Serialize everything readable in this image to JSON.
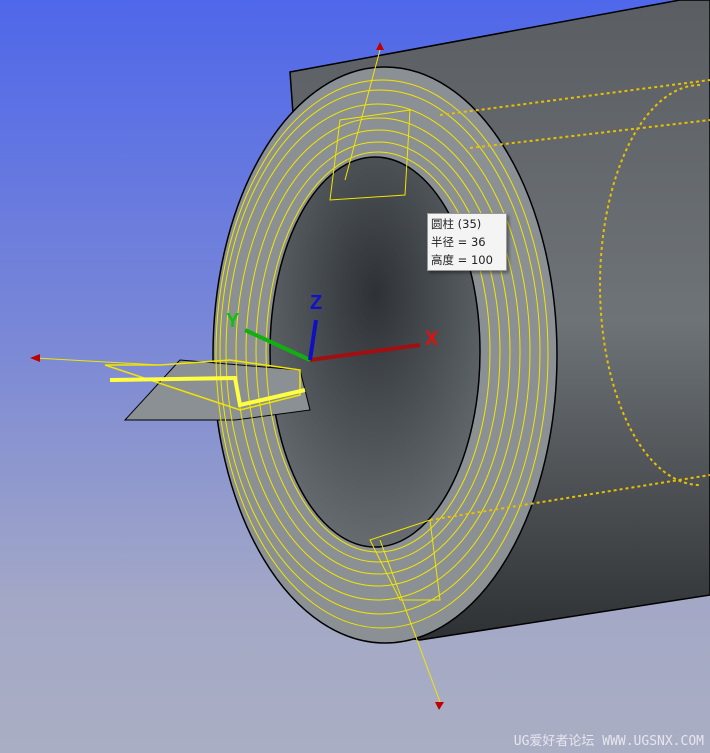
{
  "tooltip": {
    "title": "圆柱 (35)",
    "radius": "半径 = 36",
    "height": "高度 = 100"
  },
  "axes": {
    "x": "X",
    "y": "Y",
    "z": "Z"
  },
  "watermark": "UG爱好者论坛 WWW.UGSNX.COM",
  "colors": {
    "toolpath": "#f2e600",
    "x_axis": "#a01010",
    "y_axis": "#10b010",
    "z_axis": "#1010c0",
    "body": "#4a4e52"
  }
}
